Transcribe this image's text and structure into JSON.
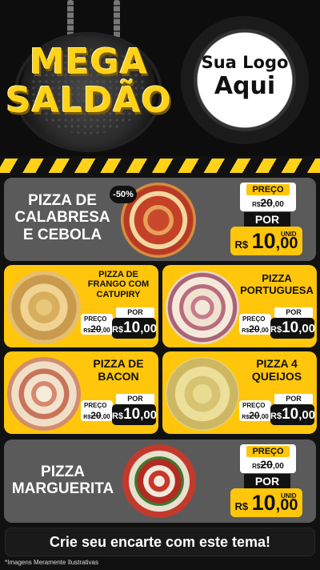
{
  "header": {
    "title_line1": "MEGA",
    "title_line2": "SALDÃO",
    "logo_line1": "Sua Logo",
    "logo_line2": "Aqui"
  },
  "colors": {
    "accent": "#ffc60b",
    "grey_card": "#5a5a5a",
    "dark": "#111111"
  },
  "price_labels": {
    "preco": "PREÇO",
    "por": "POR",
    "currency": "R$",
    "unit": "UNID"
  },
  "products": [
    {
      "name": "PIZZA DE CALABRESA E CEBOLA",
      "badge": "-50%",
      "old_int": "20",
      "old_dec": ",00",
      "new_int": "10",
      "new_dec": ",00"
    },
    {
      "name": "PIZZA DE FRANGO COM CATUPIRY",
      "old_int": "20",
      "old_dec": ",00",
      "new_int": "10",
      "new_dec": ",00"
    },
    {
      "name": "PIZZA PORTUGUESA",
      "old_int": "20",
      "old_dec": ",00",
      "new_int": "10",
      "new_dec": ",00"
    },
    {
      "name": "PIZZA DE BACON",
      "old_int": "20",
      "old_dec": ",00",
      "new_int": "10",
      "new_dec": ",00"
    },
    {
      "name": "PIZZA 4 QUEIJOS",
      "old_int": "20",
      "old_dec": ",00",
      "new_int": "10",
      "new_dec": ",00"
    },
    {
      "name": "PIZZA MARGUERITA",
      "old_int": "20",
      "old_dec": ",00",
      "new_int": "10",
      "new_dec": ",00"
    }
  ],
  "footer": {
    "cta": "Crie seu encarte com este tema!",
    "disclaimer": "*Imagens Meramente Ilustrativas"
  }
}
